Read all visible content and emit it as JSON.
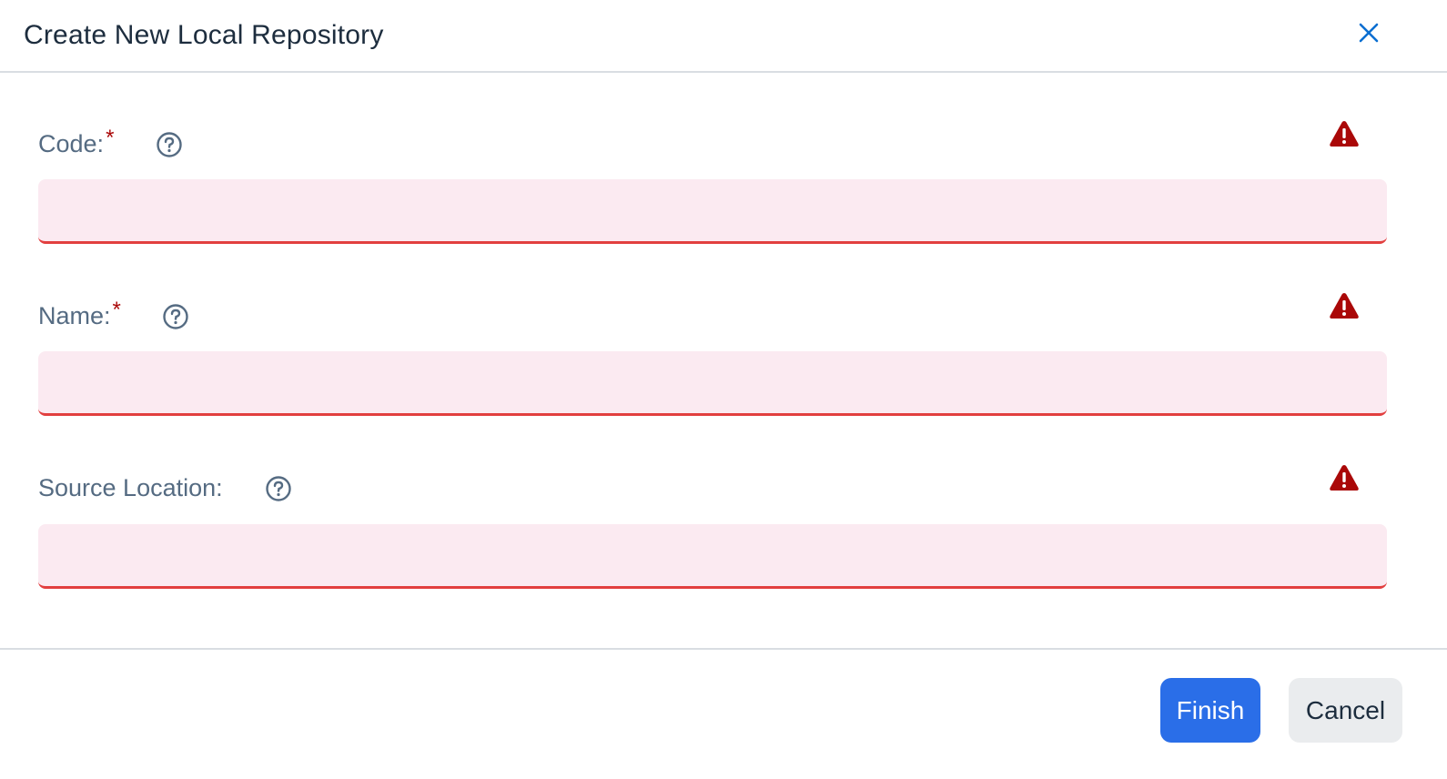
{
  "dialog": {
    "title": "Create New Local Repository",
    "close_icon": "close-icon"
  },
  "fields": [
    {
      "label": "Code:",
      "required_mark": "*",
      "value": "",
      "help_icon": "question-circle-icon",
      "status_icon": "warning-triangle-icon"
    },
    {
      "label": "Name:",
      "required_mark": "*",
      "value": "",
      "help_icon": "question-circle-icon",
      "status_icon": "warning-triangle-icon"
    },
    {
      "label": "Source Location:",
      "required_mark": "",
      "value": "",
      "help_icon": "question-circle-icon",
      "status_icon": "warning-triangle-icon"
    }
  ],
  "footer": {
    "finish_label": "Finish",
    "cancel_label": "Cancel"
  },
  "colors": {
    "accent": "#2a6ee8",
    "error": "#e23f3f",
    "warning_icon": "#aa0808",
    "input_error_bg": "#fbeaf1",
    "label": "#556b82"
  }
}
